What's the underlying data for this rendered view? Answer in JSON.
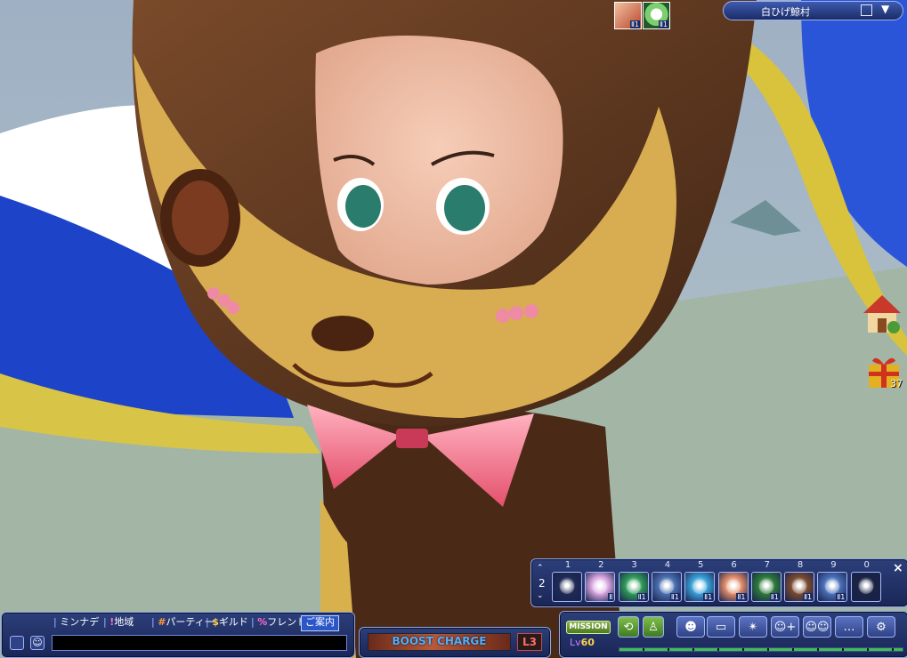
{
  "location": {
    "name": "白ひげ鯨村"
  },
  "buffs": [
    {
      "icon": "character-portrait-icon",
      "level": "Ⅱ1"
    },
    {
      "icon": "lotus-icon",
      "level": "Ⅱ1"
    }
  ],
  "side_icons": {
    "gift_count": "37"
  },
  "hotbar": {
    "page": "2",
    "close_label": "×",
    "slots": [
      {
        "num": "1",
        "icon": "dragon-skill-icon",
        "badge": ""
      },
      {
        "num": "2",
        "icon": "flower-skill-icon",
        "badge": "Ⅱ"
      },
      {
        "num": "3",
        "icon": "leaf-skill-icon",
        "badge": "Ⅱ1"
      },
      {
        "num": "4",
        "icon": "magnifier-skill-icon",
        "badge": "Ⅱ1"
      },
      {
        "num": "5",
        "icon": "sparkle-skill-icon",
        "badge": "Ⅱ1"
      },
      {
        "num": "6",
        "icon": "portrait-skill-icon",
        "badge": "Ⅱ1"
      },
      {
        "num": "7",
        "icon": "lotus-skill-icon",
        "badge": "Ⅱ1"
      },
      {
        "num": "8",
        "icon": "bearded-face-skill-icon",
        "badge": "Ⅱ1"
      },
      {
        "num": "9",
        "icon": "eye-skill-icon",
        "badge": "Ⅱ1"
      },
      {
        "num": "0",
        "icon": "fish-skill-icon",
        "badge": ""
      }
    ]
  },
  "chat": {
    "tabs": [
      "ミンナデ",
      "地域",
      "パーティー",
      "ギルド",
      "フレンド",
      "ご案内"
    ],
    "tab_prefixes": [
      "",
      "!",
      "#",
      "$",
      "%",
      ""
    ],
    "input_value": ""
  },
  "boost": {
    "label": "BOOST CHARGE",
    "level": "L3"
  },
  "menu": {
    "mission_label": "MISSION",
    "level_prefix": "Lv",
    "level_value": "60",
    "buttons": [
      "refresh-icon",
      "stand-icon",
      "character-icon",
      "inventory-icon",
      "skills-icon",
      "add-friend-icon",
      "party-icon",
      "chat-bubble-icon",
      "settings-icon"
    ]
  }
}
